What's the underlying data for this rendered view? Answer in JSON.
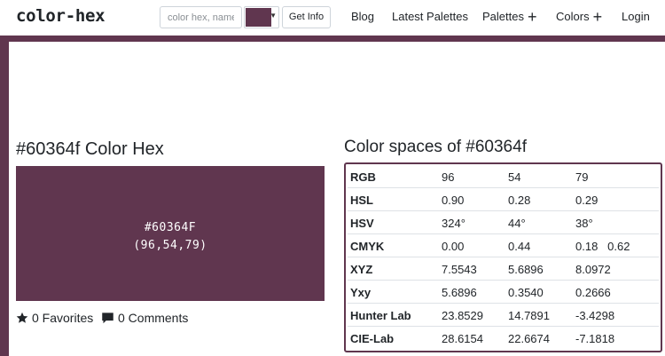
{
  "navbar": {
    "brand": "color-hex",
    "search": {
      "placeholder": "color hex, name",
      "value": ""
    },
    "picker_color": "#60364f",
    "get_info_label": "Get Info",
    "links": {
      "blog": "Blog",
      "latest_palettes": "Latest Palettes",
      "palettes": "Palettes",
      "colors": "Colors",
      "login": "Login"
    }
  },
  "main": {
    "title": "#60364f Color Hex",
    "preview": {
      "hex": "#60364F",
      "rgb": "(96,54,79)",
      "bg_color": "#60364f"
    },
    "favorites": "0 Favorites",
    "comments": "0 Comments"
  },
  "color_spaces": {
    "title": "Color spaces of #60364f",
    "rows": [
      {
        "name": "RGB",
        "values": [
          "96",
          "54",
          "79"
        ]
      },
      {
        "name": "HSL",
        "values": [
          "0.90",
          "0.28",
          "0.29"
        ]
      },
      {
        "name": "HSV",
        "values": [
          "324°",
          "44°",
          "38°"
        ]
      },
      {
        "name": "CMYK",
        "values": [
          "0.00",
          "0.44",
          "0.18   0.62"
        ]
      },
      {
        "name": "XYZ",
        "values": [
          "7.5543",
          "5.6896",
          "8.0972"
        ]
      },
      {
        "name": "Yxy",
        "values": [
          "5.6896",
          "0.3540",
          "0.2666"
        ]
      },
      {
        "name": "Hunter Lab",
        "values": [
          "23.8529",
          "14.7891",
          "-3.4298"
        ]
      },
      {
        "name": "CIE-Lab",
        "values": [
          "28.6154",
          "22.6674",
          "-7.1818"
        ]
      }
    ]
  }
}
